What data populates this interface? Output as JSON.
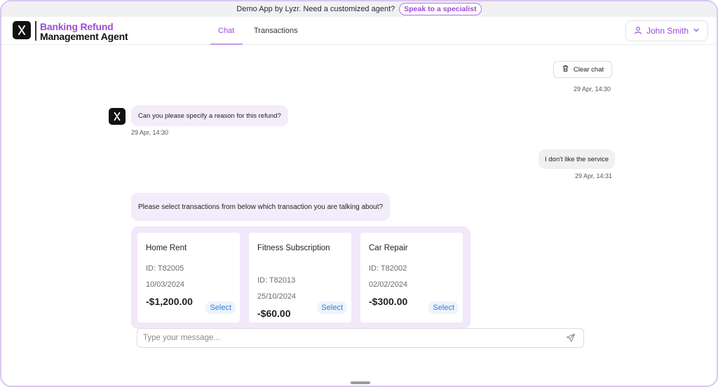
{
  "banner": {
    "text": "Demo App by Lyzr. Need a customized agent?",
    "cta_label": "Speak to a specialist"
  },
  "header": {
    "brand_line1": "Banking Refund",
    "brand_line2": "Management Agent",
    "tabs": [
      {
        "label": "Chat",
        "active": true
      },
      {
        "label": "Transactions",
        "active": false
      }
    ],
    "user_name": "John Smith",
    "icons": {
      "logo": "lyzr-logo-icon",
      "user": "user-icon",
      "dropdown": "chevron-down-icon"
    }
  },
  "chat": {
    "clear_label": "Clear chat",
    "clear_timestamp": "29 Apr, 14:30",
    "messages": [
      {
        "role": "bot",
        "text": "Can you please specify a reason for this refund?",
        "timestamp": "29 Apr, 14:30"
      },
      {
        "role": "user",
        "text": "I don't like the service",
        "timestamp": "29 Apr, 14:31"
      },
      {
        "role": "bot",
        "text": "Please select transactions from below which transaction you are talking about?"
      }
    ],
    "transactions": [
      {
        "title": "Home Rent",
        "id": "ID: T82005",
        "date": "10/03/2024",
        "amount": "-$1,200.00",
        "select_label": "Select"
      },
      {
        "title": "Fitness Subscription",
        "id": "ID: T82013",
        "date": "25/10/2024",
        "amount": "-$60.00",
        "select_label": "Select"
      },
      {
        "title": "Car Repair",
        "id": "ID: T82002",
        "date": "02/02/2024",
        "amount": "-$300.00",
        "select_label": "Select"
      }
    ]
  },
  "composer": {
    "placeholder": "Type your message..."
  },
  "colors": {
    "accent": "#9b4dd6",
    "bot_bubble": "#f3ecfb",
    "user_bubble": "#f0f0f2",
    "select_text": "#2f7de1"
  }
}
